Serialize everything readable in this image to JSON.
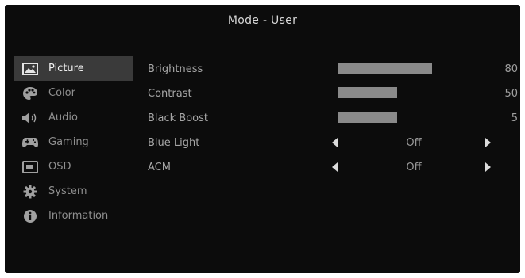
{
  "header": {
    "title": "Mode - User"
  },
  "sidebar": {
    "items": [
      {
        "label": "Picture",
        "icon": "picture-icon",
        "active": true
      },
      {
        "label": "Color",
        "icon": "palette-icon",
        "active": false
      },
      {
        "label": "Audio",
        "icon": "speaker-icon",
        "active": false
      },
      {
        "label": "Gaming",
        "icon": "gamepad-icon",
        "active": false
      },
      {
        "label": "OSD",
        "icon": "osd-icon",
        "active": false
      },
      {
        "label": "System",
        "icon": "gear-icon",
        "active": false
      },
      {
        "label": "Information",
        "icon": "info-icon",
        "active": false
      }
    ]
  },
  "settings": {
    "brightness": {
      "label": "Brightness",
      "value": "80",
      "level": 80
    },
    "contrast": {
      "label": "Contrast",
      "value": "50",
      "level": 50
    },
    "black_boost": {
      "label": "Black  Boost",
      "value": "5",
      "level": 50
    },
    "blue_light": {
      "label": "Blue  Light",
      "value": "Off"
    },
    "acm": {
      "label": "ACM",
      "value": "Off"
    }
  },
  "colors": {
    "background": "#0c0c0c",
    "active_item": "#3a3a3a",
    "bar_fill": "#8a8a8a",
    "text": "#a7a7a7"
  }
}
